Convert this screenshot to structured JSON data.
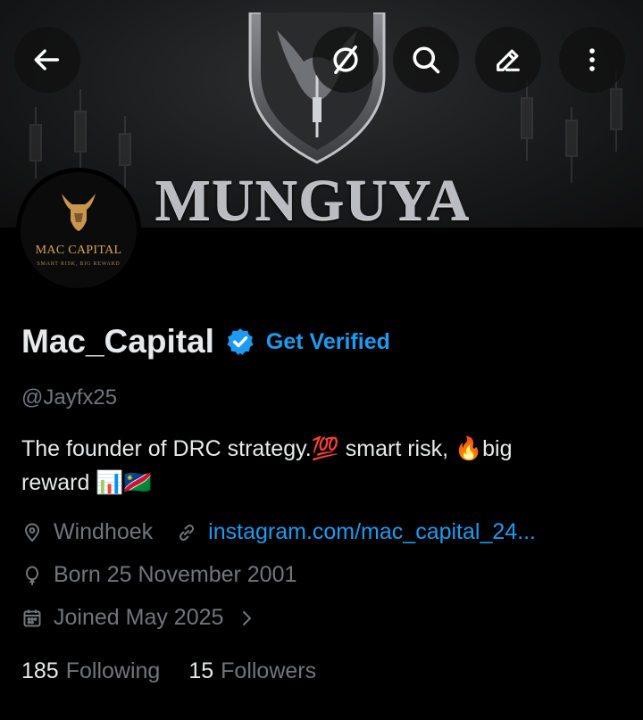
{
  "banner": {
    "brand_text": "MUNGUYA"
  },
  "top_bar": {
    "back_icon": "arrow-left-icon",
    "grok_icon": "grok-slash-circle-icon",
    "search_icon": "search-icon",
    "edit_icon": "pencil-icon",
    "more_icon": "more-vertical-icon"
  },
  "avatar": {
    "name": "MAC CAPITAL",
    "tagline": "SMART RISK, BIG REWARD"
  },
  "profile": {
    "display_name": "Mac_Capital",
    "get_verified": "Get Verified",
    "handle": "@Jayfx25",
    "bio_text_1": "The founder of DRC strategy.",
    "bio_emoji_100": "💯",
    "bio_text_2": " smart risk, ",
    "bio_emoji_fire": "🔥",
    "bio_text_3": "big",
    "bio_line2_text": "reward ",
    "bio_emoji_chart": "📊",
    "bio_emoji_flag": "🇳🇦",
    "location": "Windhoek",
    "website": "instagram.com/mac_capital_24...",
    "birthday": "Born 25 November 2001",
    "joined": "Joined May 2025",
    "following_count": "185",
    "following_label": "Following",
    "followers_count": "15",
    "followers_label": "Followers"
  },
  "colors": {
    "background": "#000000",
    "accent": "#1d9bf0",
    "secondary_text": "#71767b",
    "primary_text": "#e7e9ea",
    "avatar_gold": "#d4a35a"
  }
}
